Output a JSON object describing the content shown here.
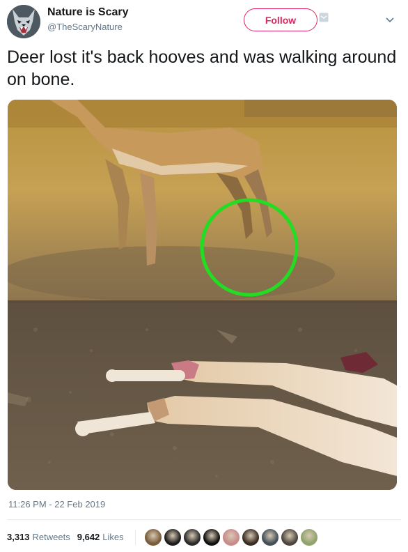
{
  "header": {
    "display_name": "Nature is Scary",
    "handle": "@TheScaryNature",
    "follow_label": "Follow"
  },
  "tweet": {
    "text": "Deer lost it's back hooves and was walking around on bone.",
    "timestamp": "11:26 PM - 22 Feb 2019"
  },
  "stats": {
    "retweets_count": "3,313",
    "retweets_label": "Retweets",
    "likes_count": "9,642",
    "likes_label": "Likes"
  },
  "likers": [
    {
      "name": "liker-avatar-1",
      "color": "#7a5c3a"
    },
    {
      "name": "liker-avatar-2",
      "color": "#1d1d1d"
    },
    {
      "name": "liker-avatar-3",
      "color": "#2b2b2b"
    },
    {
      "name": "liker-avatar-4",
      "color": "#111111"
    },
    {
      "name": "liker-avatar-5",
      "color": "#c98a8a"
    },
    {
      "name": "liker-avatar-6",
      "color": "#3a2e24"
    },
    {
      "name": "liker-avatar-7",
      "color": "#445058"
    },
    {
      "name": "liker-avatar-8",
      "color": "#4e463f"
    },
    {
      "name": "liker-avatar-9",
      "color": "#8fa36b"
    }
  ],
  "colors": {
    "accent": "#e0245e",
    "secondary_text": "#657786",
    "highlight_circle": "#22dd22"
  }
}
